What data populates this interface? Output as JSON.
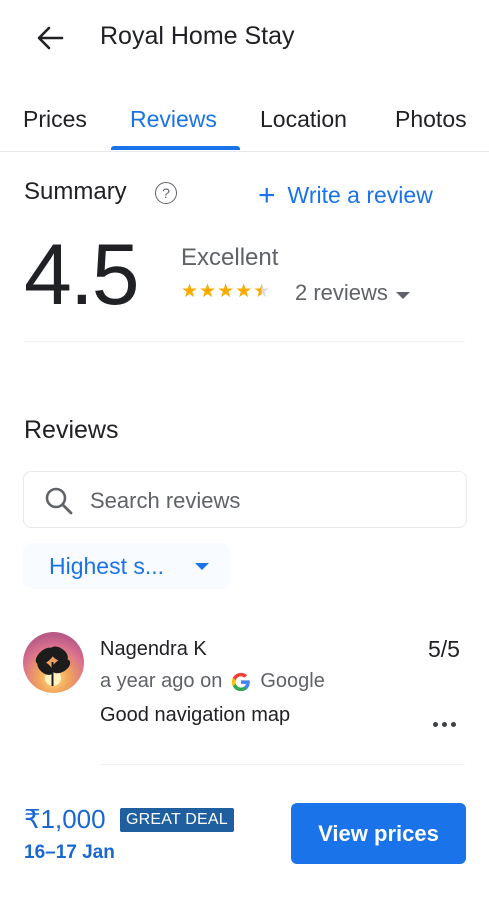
{
  "header": {
    "title": "Royal Home Stay",
    "back_icon": "arrow-left-icon"
  },
  "tabs": [
    {
      "label": "Prices",
      "active": false
    },
    {
      "label": "Reviews",
      "active": true
    },
    {
      "label": "Location",
      "active": false
    },
    {
      "label": "Photos",
      "active": false
    }
  ],
  "summary": {
    "title": "Summary",
    "help_glyph": "?",
    "write_review_label": "Write a review",
    "plus_glyph": "+",
    "rating": "4.5",
    "rating_word": "Excellent",
    "stars": 4.5,
    "review_count_label": "2 reviews"
  },
  "reviews_section": {
    "heading": "Reviews",
    "search_placeholder": "Search reviews",
    "sort_label": "Highest s..."
  },
  "review_items": [
    {
      "name": "Nagendra K",
      "score": "5/5",
      "time": "a year ago on",
      "source": "Google",
      "text": "Good navigation map"
    }
  ],
  "footer": {
    "price": "₹1,000",
    "deal_badge": "GREAT DEAL",
    "dates": "16–17 Jan",
    "cta_label": "View prices"
  },
  "colors": {
    "accent": "#1a73e8",
    "star": "#f9ab00",
    "badge": "#1f5fa0",
    "price": "#1967d2"
  }
}
